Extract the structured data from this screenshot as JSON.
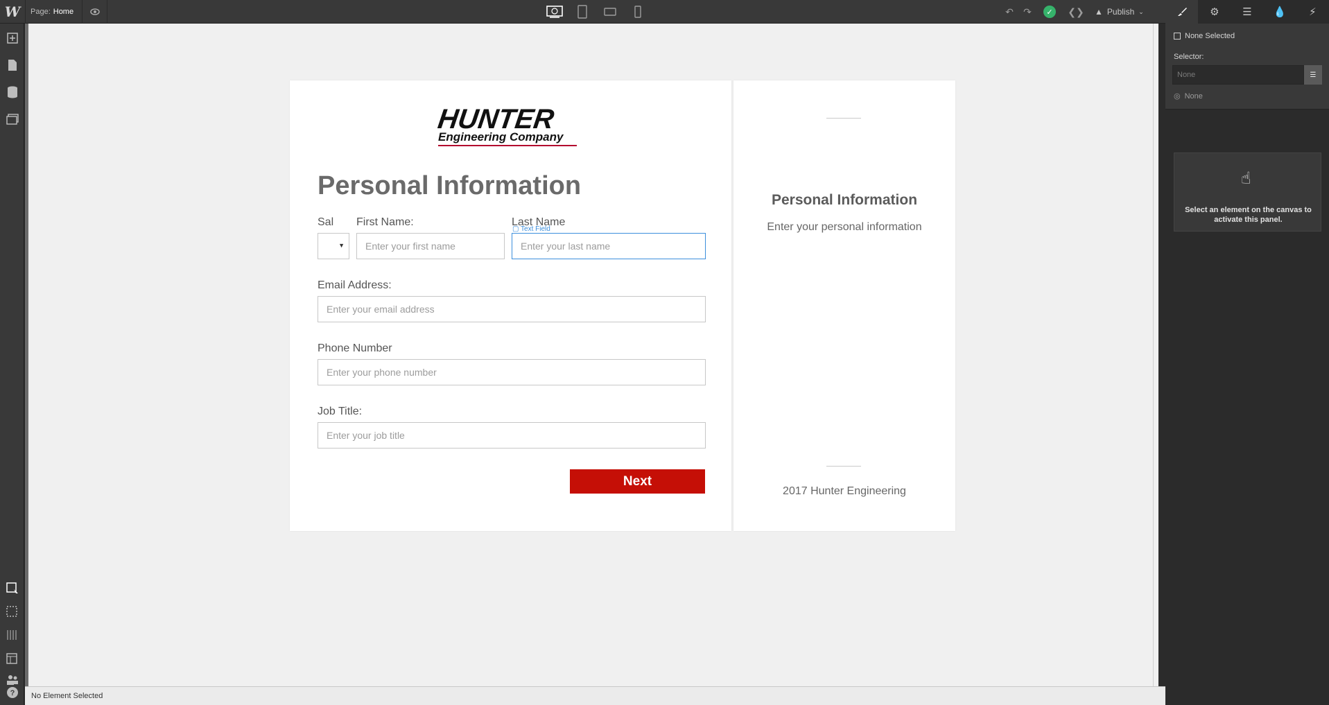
{
  "topbar": {
    "logo": "W",
    "page_prefix": "Page:",
    "page_name": "Home",
    "publish_label": "Publish",
    "device_icons": [
      "desktop-icon",
      "tablet-icon",
      "phone-landscape-icon",
      "phone-portrait-icon"
    ]
  },
  "form": {
    "brand_top": "HUNTER",
    "brand_bottom": "Engineering Company",
    "title": "Personal Information",
    "sal_label": "Sal",
    "first_label": "First Name:",
    "first_placeholder": "Enter your first name",
    "last_label": "Last Name",
    "last_placeholder": "Enter your last name",
    "text_field_tag": "Text Field",
    "email_label": "Email Address:",
    "email_placeholder": "Enter your email address",
    "phone_label": "Phone Number",
    "phone_placeholder": "Enter your phone number",
    "job_label": "Job Title:",
    "job_placeholder": "Enter your job title",
    "next_label": "Next"
  },
  "sidebar_card": {
    "title": "Personal Information",
    "subtitle": "Enter your personal information",
    "footer": "2017 Hunter Engineering"
  },
  "right_panel": {
    "none_selected": "None Selected",
    "selector_label": "Selector:",
    "selector_placeholder": "None",
    "state_label": "None",
    "activate_text": "Select an element on the canvas to activate this panel."
  },
  "status": {
    "text": "No Element Selected"
  },
  "colors": {
    "accent": "#c50f06",
    "focus": "#3b8edc",
    "publish_ok": "#36b36b"
  }
}
